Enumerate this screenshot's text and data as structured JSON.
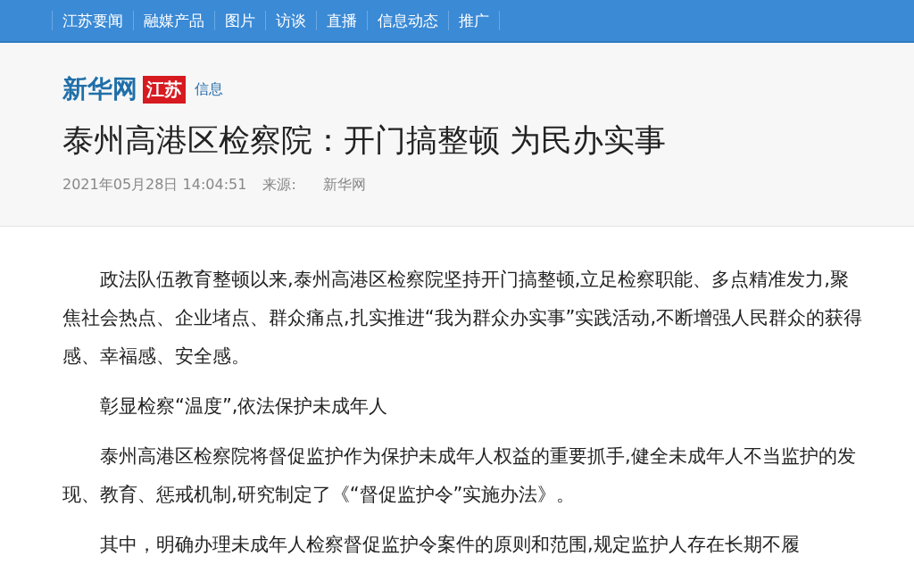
{
  "nav": {
    "items": [
      "江苏要闻",
      "融媒产品",
      "图片",
      "访谈",
      "直播",
      "信息动态",
      "推广"
    ]
  },
  "logo": {
    "site": "新华网",
    "region": "江苏",
    "section": "信息"
  },
  "article": {
    "title": "泰州高港区检察院：开门搞整顿 为民办实事",
    "date": "2021年05月28日 14:04:51",
    "source_label": "来源:",
    "source": "新华网",
    "paragraphs": [
      "政法队伍教育整顿以来,泰州高港区检察院坚持开门搞整顿,立足检察职能、多点精准发力,聚焦社会热点、企业堵点、群众痛点,扎实推进“我为群众办实事”实践活动,不断增强人民群众的获得感、幸福感、安全感。",
      "彰显检察“温度”,依法保护未成年人",
      "泰州高港区检察院将督促监护作为保护未成年人权益的重要抓手,健全未成年人不当监护的发现、教育、惩戒机制,研究制定了《“督促监护令”实施办法》。",
      "其中，明确办理未成年人检察督促监护令案件的原则和范围,规定监护人存在长期不履"
    ]
  }
}
